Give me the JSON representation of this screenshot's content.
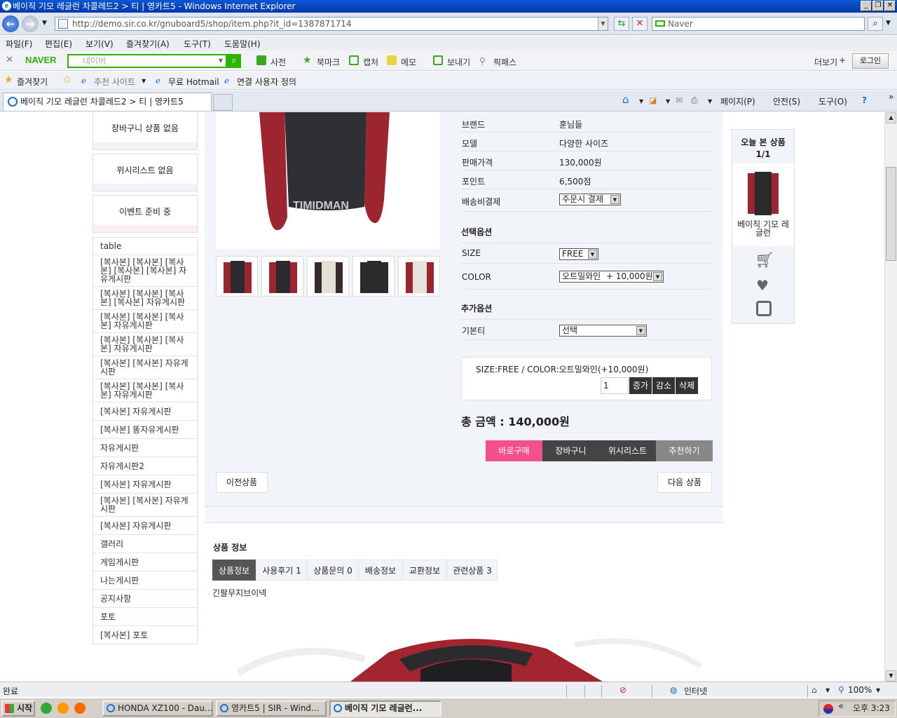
{
  "window": {
    "title": "베이직 기모 레글런 차콜레드2 > 티 | 영카트5 - Windows Internet Explorer",
    "address": "http://demo.sir.co.kr/gnuboard5/shop/item.php?it_id=1387871714",
    "search_placeholder": "Naver",
    "menu": [
      "파일(F)",
      "편집(E)",
      "보기(V)",
      "즐겨찾기(A)",
      "도구(T)",
      "도움말(H)"
    ],
    "naver_toolbar": {
      "logo": "NAVER",
      "input_placeholder": "네이버",
      "items": [
        "사전",
        "북마크",
        "캡처",
        "메모",
        "보내기",
        "픽패스"
      ],
      "more": "더보기",
      "login": "로그인"
    },
    "favorites": {
      "label": "즐겨찾기",
      "items": [
        "추천 사이트",
        "무료 Hotmail",
        "연결 사용자 정의"
      ]
    },
    "tab_title": "베이직 기모 레글런 차콜레드2 > 티 | 영카트5",
    "commands": [
      "페이지(P)",
      "안전(S)",
      "도구(O)"
    ],
    "status": {
      "text": "완료",
      "zone": "인터넷",
      "zoom": "100%"
    }
  },
  "taskbar": {
    "start": "시작",
    "tasks": [
      "HONDA XZ100 - Dau...",
      "영카트5 | SIR - Wind...",
      "베이직 기모 레글런..."
    ],
    "clock": "오후 3:23"
  },
  "sidebar": {
    "boxes": [
      "장바구니 상품 없음",
      "위시리스트 없음",
      "이벤트 준비 중"
    ],
    "nav": [
      "table",
      "[복사본] [복사본] [복사본] [복사본] [복사본] 자유게시판",
      "[복사본] [복사본] [복사본] [복사본] 자유게시판",
      "[복사본] [복사본] [복사본] 자유게시판",
      "[복사본] [복사본] [복사본] 자유게시판",
      "[복사본] [복사본] 자유게시판",
      "[복사본] [복사본] [복사본] 자유게시판",
      "[복사본] 자유게시판",
      "[복사본] 똥자유게시판",
      "자유게시판",
      "자유게시판2",
      "[복사본] 자유게시판",
      "[복사본] [복사본] 자유게시판",
      "[복사본] 자유게시판",
      "갤러리",
      "게임게시판",
      "나는게시판",
      "공지사항",
      "포토",
      "[복사본] 포토"
    ]
  },
  "product": {
    "watermark": "TIMIDMAN",
    "info": [
      {
        "label": "브랜드",
        "value": "훈님들"
      },
      {
        "label": "모델",
        "value": "다양한 사이즈"
      },
      {
        "label": "판매가격",
        "value": "130,000원"
      },
      {
        "label": "포인트",
        "value": "6,500점"
      }
    ],
    "shipping_label": "배송비결제",
    "shipping_value": "주문시 결제",
    "select_options_title": "선택옵션",
    "size_label": "SIZE",
    "size_value": "FREE",
    "color_label": "COLOR",
    "color_value": "오트밀와인  + 10,000원",
    "extra_options_title": "추가옵션",
    "basic_label": "기본티",
    "basic_value": "선택",
    "selected_option": "SIZE:FREE / COLOR:오트밀와인(+10,000원)",
    "qty": "1",
    "qty_buttons": [
      "증가",
      "감소",
      "삭제"
    ],
    "total": "총 금액 : 140,000원",
    "actions": [
      "바로구매",
      "장바구니",
      "위시리스트",
      "추천하기"
    ],
    "prev": "이전상품",
    "next": "다음 상품"
  },
  "today": {
    "title": "오늘 본 상품",
    "page": "1/1",
    "item_name": "베이직 기모 레글런"
  },
  "details": {
    "title": "상품 정보",
    "tabs": [
      "상품정보",
      "사용후기 1",
      "상품문의 0",
      "배송정보",
      "교환정보",
      "관련상품 3"
    ],
    "description": "긴팔무지브이넥"
  },
  "colors": {
    "buy_now": "#f4508a",
    "dark_button": "#444444",
    "recommend": "#888888",
    "naver_green": "#2db400",
    "panel_bg": "#f1f4f9"
  }
}
